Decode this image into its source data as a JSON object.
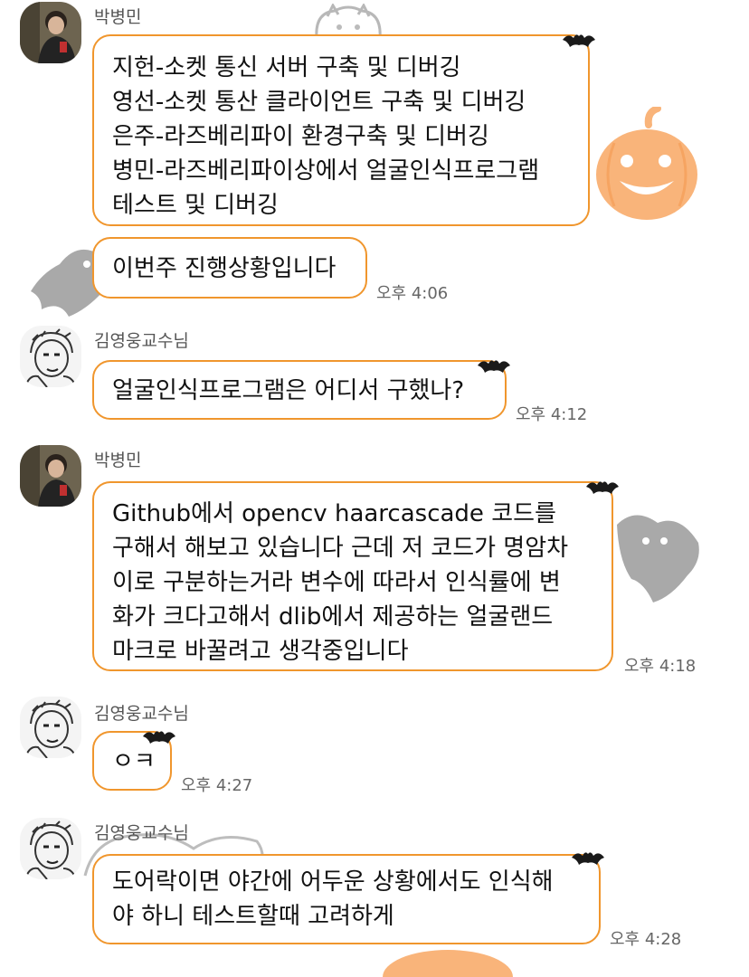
{
  "colors": {
    "bubble_border": "#f0962d",
    "pumpkin": "#f9b47a",
    "ghost": "#9a9a9a",
    "bat": "#1a1a1a"
  },
  "messages": [
    {
      "sender": "박병민",
      "avatar": "user-photo-avatar",
      "lines": [
        "지헌-소켓 통신 서버 구축 및 디버깅",
        "영선-소켓 통산 클라이언트 구축 및 디버깅",
        "은주-라즈베리파이 환경구축 및 디버깅",
        "병민-라즈베리파이상에서 얼굴인식프로그램",
        "테스트 및 디버깅"
      ],
      "time": ""
    },
    {
      "sender": "",
      "lines": [
        "이번주 진행상황입니다"
      ],
      "time": "오후 4:06"
    },
    {
      "sender": "김영웅교수님",
      "avatar": "sketch-portrait-avatar",
      "lines": [
        "얼굴인식프로그램은 어디서 구했나?"
      ],
      "time": "오후 4:12"
    },
    {
      "sender": "박병민",
      "avatar": "user-photo-avatar",
      "lines": [
        "Github에서 opencv haarcascade 코드를",
        "구해서 해보고 있습니다 근데 저 코드가 명암차",
        "이로 구분하는거라 변수에 따라서 인식률에 변",
        "화가 크다고해서 dlib에서 제공하는 얼굴랜드",
        "마크로 바꿀려고 생각중입니다"
      ],
      "time": "오후 4:18"
    },
    {
      "sender": "김영웅교수님",
      "avatar": "sketch-portrait-avatar",
      "lines": [
        "ㅇㅋ"
      ],
      "time": "오후 4:27"
    },
    {
      "sender": "김영웅교수님",
      "avatar": "sketch-portrait-avatar",
      "lines": [
        "도어락이면 야간에 어두운 상황에서도 인식해",
        "야 하니 테스트할때 고려하게"
      ],
      "time": "오후 4:28"
    }
  ]
}
